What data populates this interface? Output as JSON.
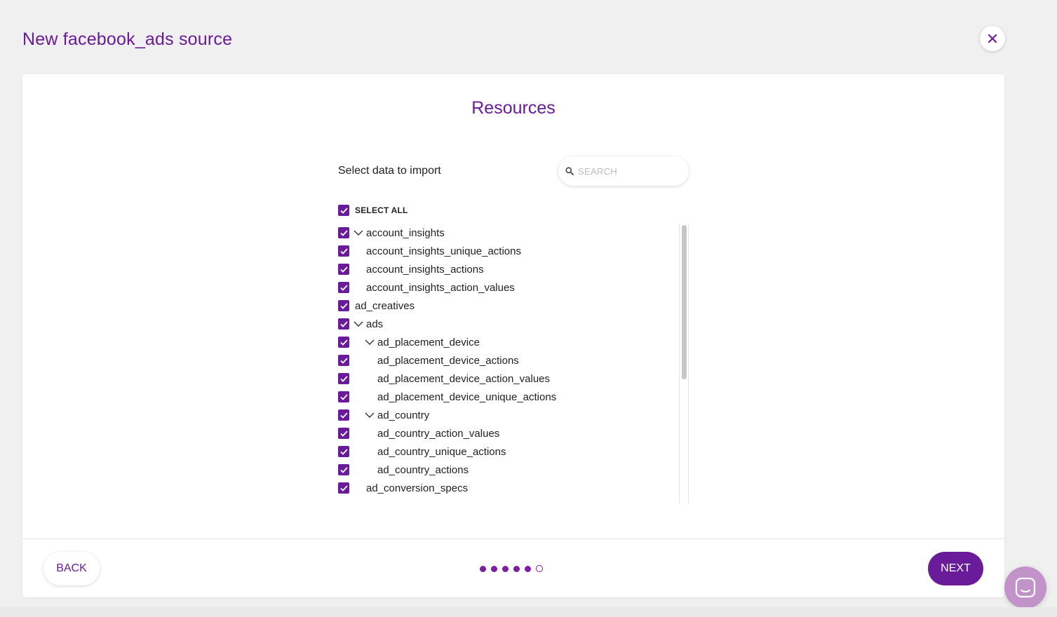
{
  "header": {
    "title": "New facebook_ads source"
  },
  "panel": {
    "title": "Resources",
    "select_label": "Select data to import",
    "search": {
      "placeholder": "SEARCH",
      "value": ""
    },
    "select_all": {
      "label": "SELECT ALL",
      "checked": true
    }
  },
  "tree": [
    {
      "label": "account_insights",
      "level": 0,
      "expandable": true,
      "expanded": true,
      "checked": true
    },
    {
      "label": "account_insights_unique_actions",
      "level": 1,
      "expandable": false,
      "checked": true
    },
    {
      "label": "account_insights_actions",
      "level": 1,
      "expandable": false,
      "checked": true
    },
    {
      "label": "account_insights_action_values",
      "level": 1,
      "expandable": false,
      "checked": true
    },
    {
      "label": "ad_creatives",
      "level": 0,
      "expandable": false,
      "checked": true
    },
    {
      "label": "ads",
      "level": 0,
      "expandable": true,
      "expanded": true,
      "checked": true
    },
    {
      "label": "ad_placement_device",
      "level": 1,
      "expandable": true,
      "expanded": true,
      "checked": true
    },
    {
      "label": "ad_placement_device_actions",
      "level": 2,
      "expandable": false,
      "checked": true
    },
    {
      "label": "ad_placement_device_action_values",
      "level": 2,
      "expandable": false,
      "checked": true
    },
    {
      "label": "ad_placement_device_unique_actions",
      "level": 2,
      "expandable": false,
      "checked": true
    },
    {
      "label": "ad_country",
      "level": 1,
      "expandable": true,
      "expanded": true,
      "checked": true
    },
    {
      "label": "ad_country_action_values",
      "level": 2,
      "expandable": false,
      "checked": true
    },
    {
      "label": "ad_country_unique_actions",
      "level": 2,
      "expandable": false,
      "checked": true
    },
    {
      "label": "ad_country_actions",
      "level": 2,
      "expandable": false,
      "checked": true
    },
    {
      "label": "ad_conversion_specs",
      "level": 1,
      "expandable": false,
      "checked": true
    }
  ],
  "footer": {
    "back_label": "BACK",
    "next_label": "NEXT",
    "steps_total": 6,
    "steps_completed": 5
  },
  "colors": {
    "accent": "#6a1b9a",
    "chat_launcher": "#c293c9"
  },
  "icons": {
    "close": "close-icon",
    "search": "search-icon",
    "chevron": "chevron-down-icon",
    "check": "check-icon",
    "chat": "chat-icon"
  }
}
